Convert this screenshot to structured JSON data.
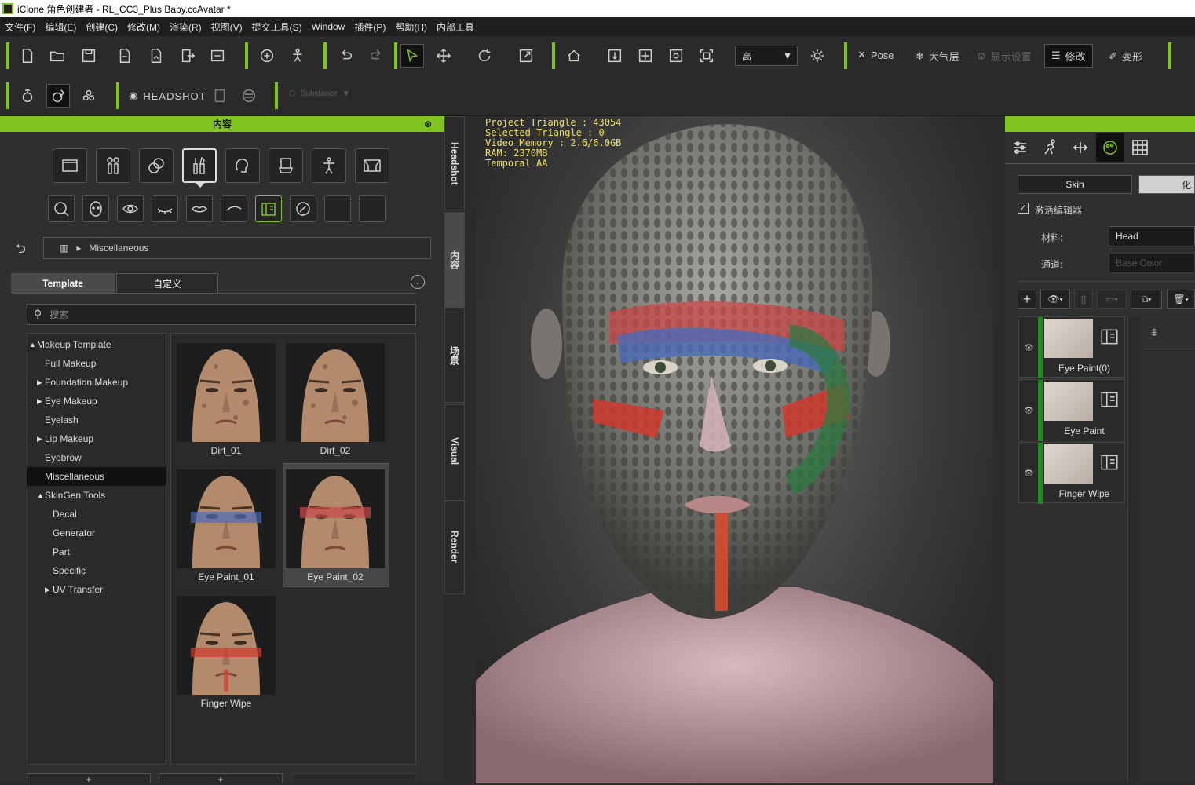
{
  "window": {
    "title": "iClone 角色创建者 - RL_CC3_Plus Baby.ccAvatar *"
  },
  "menu": [
    "文件(F)",
    "编辑(E)",
    "创建(C)",
    "修改(M)",
    "渲染(R)",
    "视图(V)",
    "提交工具(S)",
    "Window",
    "插件(P)",
    "帮助(H)",
    "内部工具"
  ],
  "toolbar": {
    "quality_value": "高",
    "pose_label": "Pose",
    "atmosphere_label": "大气层",
    "hidden_label": "显示设置",
    "modify_label": "修改",
    "morph_label": "变形",
    "headshot_label": "HEADSHOT",
    "substance_label": "Substance"
  },
  "left_panel": {
    "header": "内容",
    "breadcrumb": "Miscellaneous",
    "tabs": [
      "Template",
      "自定义"
    ],
    "search_placeholder": "搜索",
    "tree": [
      {
        "label": "Makeup Template",
        "level": 0,
        "arrow": "▲"
      },
      {
        "label": "Full Makeup",
        "level": 1,
        "arrow": ""
      },
      {
        "label": "Foundation Makeup",
        "level": 1,
        "arrow": "▶"
      },
      {
        "label": "Eye Makeup",
        "level": 1,
        "arrow": "▶"
      },
      {
        "label": "Eyelash",
        "level": 1,
        "arrow": ""
      },
      {
        "label": "Lip Makeup",
        "level": 1,
        "arrow": "▶"
      },
      {
        "label": "Eyebrow",
        "level": 1,
        "arrow": ""
      },
      {
        "label": "Miscellaneous",
        "level": 1,
        "arrow": "",
        "selected": true
      },
      {
        "label": "SkinGen Tools",
        "level": 1,
        "arrow": "▲"
      },
      {
        "label": "Decal",
        "level": 2,
        "arrow": ""
      },
      {
        "label": "Generator",
        "level": 2,
        "arrow": ""
      },
      {
        "label": "Part",
        "level": 2,
        "arrow": ""
      },
      {
        "label": "Specific",
        "level": 2,
        "arrow": ""
      },
      {
        "label": "UV Transfer",
        "level": 2,
        "arrow": "▶"
      }
    ],
    "thumbnails": [
      "Dirt_01",
      "Dirt_02",
      "Eye Paint_01",
      "Eye Paint_02",
      "Finger Wipe"
    ]
  },
  "side_tabs": [
    "Headshot",
    "内容",
    "场景",
    "Visual",
    "Render"
  ],
  "viewport": {
    "stats": [
      "Project Triangle : 43054",
      "Selected Triangle : 0",
      "Video Memory : 2.6/6.0GB",
      "RAM: 2370MB",
      "Temporal AA"
    ]
  },
  "right_panel": {
    "skin_tab": "Skin",
    "makeup_tab": "化",
    "activate_label": "激活编辑器",
    "material_label": "材料:",
    "material_value": "Head",
    "channel_label": "通道:",
    "channel_value": "Base Color",
    "layers": [
      "Eye Paint(0)",
      "Eye Paint",
      "Finger Wipe"
    ]
  }
}
